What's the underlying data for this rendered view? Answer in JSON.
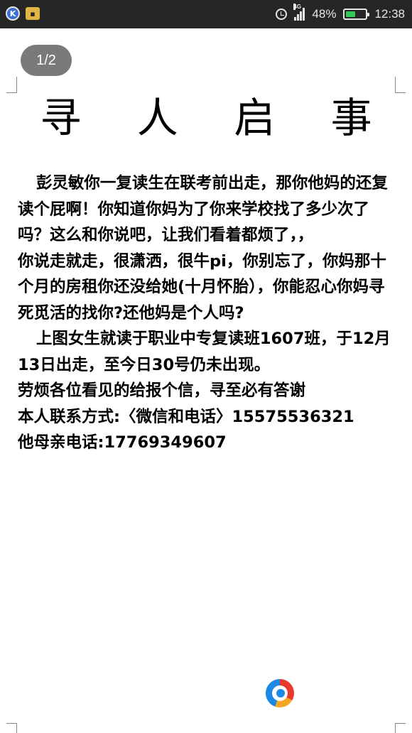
{
  "status_bar": {
    "network": "4G",
    "battery": "48%",
    "battery_level": 0.48,
    "time": "12:38",
    "icons": [
      "k-app-icon",
      "tv-app-icon",
      "alarm-icon",
      "signal-icon",
      "battery-icon"
    ]
  },
  "viewer": {
    "page_indicator": "1/2"
  },
  "document": {
    "title": "寻 人 启 事",
    "paragraphs": [
      "彭灵敏你一复读生在联考前出走，那你他妈的还复读个屁啊！你知道你妈为了你来学校找了多少次了吗？这么和你说吧，让我们看着都烦了，，",
      "你说走就走，很潇洒，很牛pi，你别忘了，你妈那十个月的房租你还没给她(十月怀胎），你能忍心你妈寻死觅活的找你?还他妈是个人吗?",
      "上图女生就读于职业中专复读班1607班，于12月13日出走，至今日30号仍未出现。",
      "劳烦各位看见的给报个信，寻至必有答谢",
      "本人联系方式:〈微信和电话〉15575536321",
      "他母亲电话:17769349607"
    ]
  },
  "colors": {
    "status_bar_bg": "#262626",
    "battery_fill": "#34c759",
    "page_chip_bg": "#7a7a7a"
  }
}
